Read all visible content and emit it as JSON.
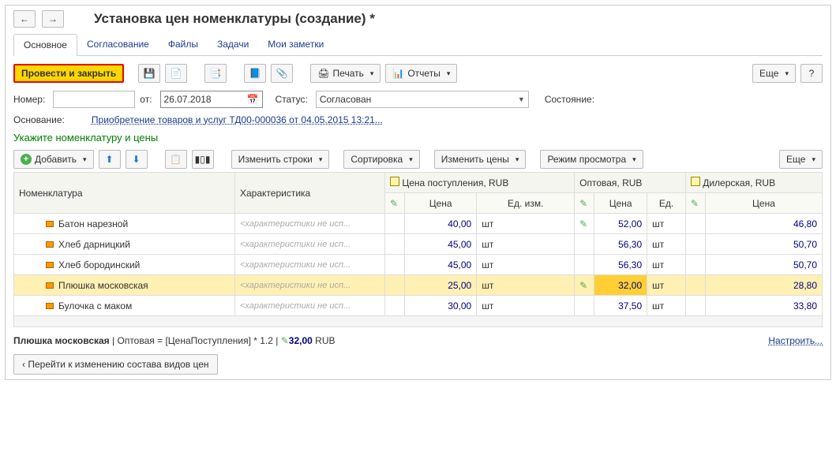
{
  "nav": {
    "back": "←",
    "forward": "→"
  },
  "title": "Установка цен номенклатуры (создание) *",
  "tabs": [
    "Основное",
    "Согласование",
    "Файлы",
    "Задачи",
    "Мои заметки"
  ],
  "active_tab_index": 0,
  "toolbar": {
    "primary": "Провести и закрыть",
    "print": "Печать",
    "reports": "Отчеты",
    "more": "Еще",
    "help": "?"
  },
  "form": {
    "number_label": "Номер:",
    "number": "",
    "from_label": "от:",
    "date": "26.07.2018",
    "status_label": "Статус:",
    "status": "Согласован",
    "state_label": "Состояние:",
    "basis_label": "Основание:",
    "basis_link": "Приобретение товаров и услуг ТД00-000036 от 04.05.2015 13:21..."
  },
  "section_title": "Укажите номенклатуру и цены",
  "grid_toolbar": {
    "add": "Добавить",
    "change_rows": "Изменить строки",
    "sort": "Сортировка",
    "change_prices": "Изменить цены",
    "view_mode": "Режим просмотра",
    "more": "Еще"
  },
  "grid": {
    "headers": {
      "nomenclature": "Номенклатура",
      "characteristic": "Характеристика",
      "group1": "Цена поступления, RUB",
      "group2": "Оптовая, RUB",
      "group3": "Дилерская, RUB"
    },
    "sub": {
      "price": "Цена",
      "unit1": "Ед. изм.",
      "unit2": "Ед."
    },
    "char_placeholder": "<характеристики не исп...",
    "rows": [
      {
        "name": "Батон нарезной",
        "p1": "40,00",
        "u1": "шт",
        "pen": true,
        "p2": "52,00",
        "u2": "шт",
        "p3": "46,80"
      },
      {
        "name": "Хлеб дарницкий",
        "p1": "45,00",
        "u1": "шт",
        "pen": false,
        "p2": "56,30",
        "u2": "шт",
        "p3": "50,70"
      },
      {
        "name": "Хлеб бородинский",
        "p1": "45,00",
        "u1": "шт",
        "pen": false,
        "p2": "56,30",
        "u2": "шт",
        "p3": "50,70"
      },
      {
        "name": "Плюшка московская",
        "p1": "25,00",
        "u1": "шт",
        "pen": true,
        "p2": "32,00",
        "u2": "шт",
        "p3": "28,80",
        "selected": true
      },
      {
        "name": "Булочка с маком",
        "p1": "30,00",
        "u1": "шт",
        "pen": false,
        "p2": "37,50",
        "u2": "шт",
        "p3": "33,80"
      }
    ]
  },
  "footer": {
    "item": "Плюшка московская",
    "sep": " | ",
    "pt": "Оптовая",
    "eq": " = ",
    "formula": " [ЦенаПоступления]  *  1.2 | ",
    "price": "32,00",
    "cur": " RUB",
    "settings": "Настроить..."
  },
  "bottom_button": "Перейти к изменению состава видов цен"
}
